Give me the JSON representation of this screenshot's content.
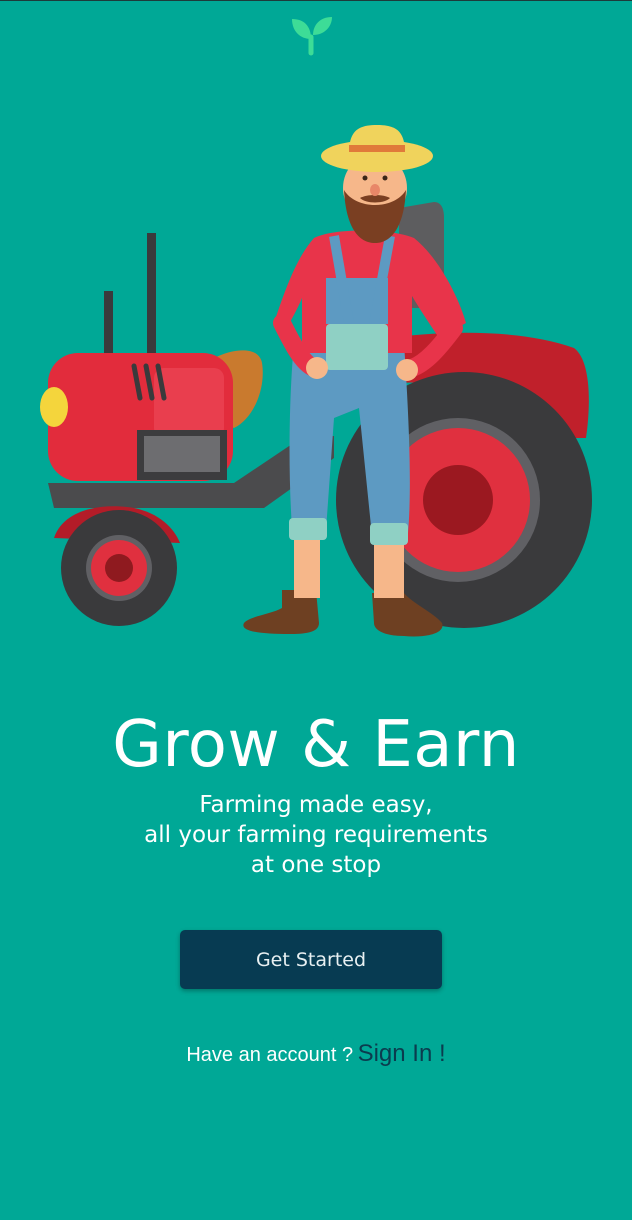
{
  "app": {
    "logo_icon": "sprout-icon",
    "hero_image": "farmer-with-tractor-illustration"
  },
  "hero": {
    "title": "Grow & Earn",
    "subtitle_lines": [
      "Farming made easy,",
      "all your farming requirements",
      "at one stop"
    ]
  },
  "actions": {
    "get_started_label": "Get Started",
    "account_prompt": "Have an account ?",
    "sign_in_label": "Sign In",
    "sign_in_suffix": " !"
  },
  "colors": {
    "background": "#00a896",
    "button": "#073b52",
    "link": "#0b3c4e",
    "logo": "#3ddc97"
  }
}
